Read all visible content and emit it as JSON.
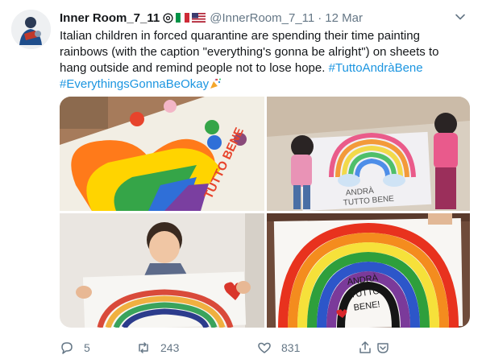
{
  "tweet": {
    "display_name": "Inner Room_7_11",
    "handle": "@InnerRoom_7_11",
    "separator": "·",
    "date": "12 Mar",
    "text_parts": {
      "body": "Italian children in forced quarantine are spending their time painting rainbows (with the caption \"everything's gonna be alright\") on sheets to hang outside and remind people not to lose hope. ",
      "hashtag1": "#TuttoAndràBene",
      "hashtag2": "#EverythingsGonnaBeOkay"
    },
    "photos": [
      {
        "painted_text": "TUTTO BENE"
      },
      {
        "painted_text_line1": "ANDRÀ",
        "painted_text_line2": "TUTTO BENE"
      },
      {},
      {
        "painted_text_line1": "ANDRÀ",
        "painted_text_line2": "TUTTO",
        "painted_text_line3": "BENE!"
      }
    ]
  },
  "actions": {
    "reply_count": "5",
    "retweet_count": "243",
    "like_count": "831"
  },
  "colors": {
    "link": "#1b95e0",
    "muted": "#657786",
    "text": "#14171a"
  }
}
